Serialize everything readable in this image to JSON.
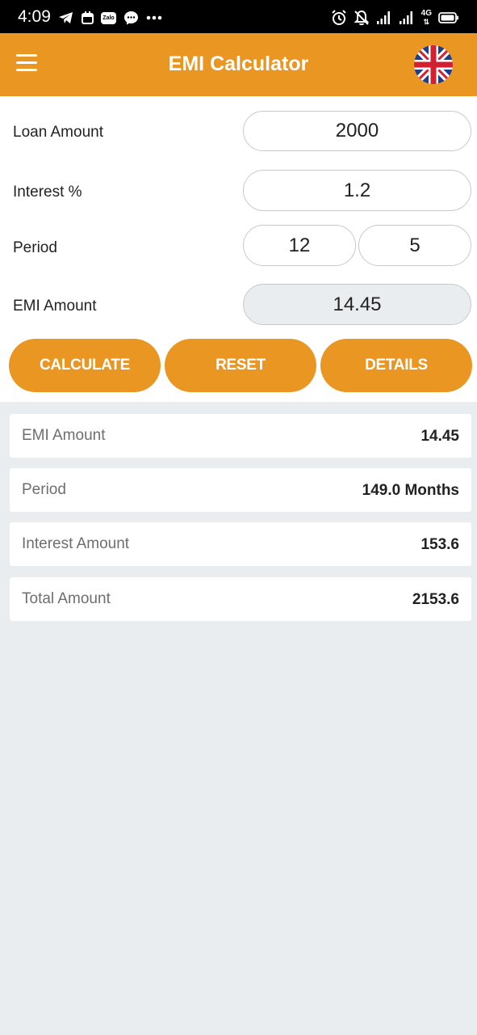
{
  "status_bar": {
    "time": "4:09",
    "network_label": "4G",
    "left_icons": [
      "telegram-icon",
      "calendar-icon",
      "zalo-icon",
      "messenger-icon",
      "more-dots-icon"
    ],
    "right_icons": [
      "alarm-icon",
      "notifications-off-icon",
      "signal-icon",
      "signal-icon",
      "network-4g-icon",
      "battery-icon"
    ],
    "zalo_text": "Zalo"
  },
  "app_bar": {
    "title": "EMI Calculator",
    "menu_icon": "menu-icon",
    "language_flag_icon": "uk-flag-icon",
    "accent_color": "#e99722"
  },
  "form": {
    "loan_amount": {
      "label": "Loan Amount",
      "value": "2000"
    },
    "interest": {
      "label": "Interest %",
      "value": "1.2"
    },
    "period": {
      "label": "Period",
      "value_1": "12",
      "value_2": "5"
    },
    "emi_amount": {
      "label": "EMI Amount",
      "value": "14.45"
    }
  },
  "buttons": {
    "calculate": "CALCULATE",
    "reset": "RESET",
    "details": "DETAILS"
  },
  "results": [
    {
      "label": "EMI Amount",
      "value": "14.45"
    },
    {
      "label": "Period",
      "value": "149.0 Months"
    },
    {
      "label": "Interest Amount",
      "value": "153.6"
    },
    {
      "label": "Total Amount",
      "value": "2153.6"
    }
  ]
}
